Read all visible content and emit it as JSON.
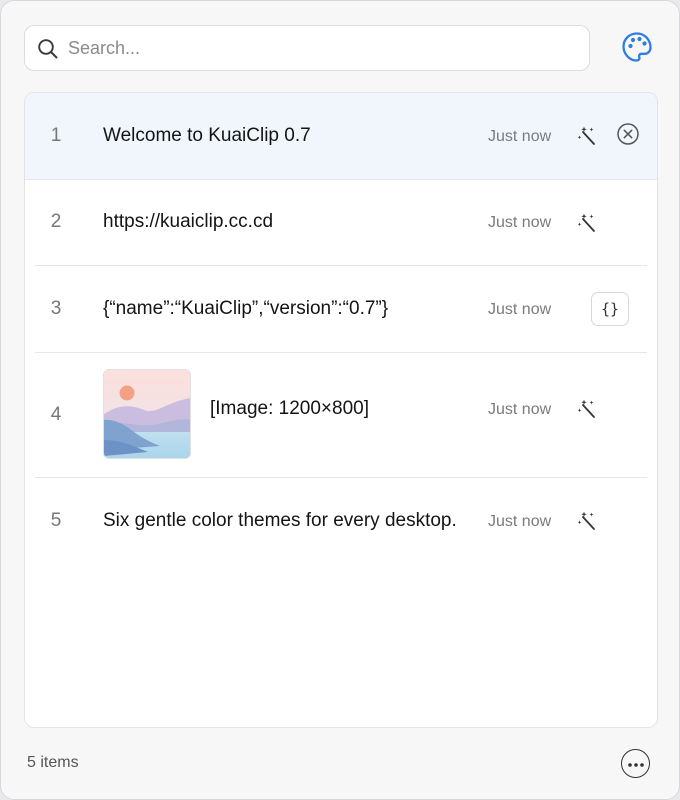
{
  "search": {
    "placeholder": "Search...",
    "value": ""
  },
  "header": {
    "palette_icon": "palette-icon",
    "accent_color": "#2f7de1"
  },
  "items": [
    {
      "index": "1",
      "text": "Welcome to KuaiClip 0.7",
      "time": "Just now",
      "action": "magic-wand-icon",
      "selected": true
    },
    {
      "index": "2",
      "text": "https://kuaiclip.cc.cd",
      "time": "Just now",
      "action": "magic-wand-icon"
    },
    {
      "index": "3",
      "text": "{“name”:“KuaiClip”,“version”:“0.7”}",
      "time": "Just now",
      "action_label": "{}"
    },
    {
      "index": "4",
      "text": "[Image: 1200×800]",
      "time": "Just now",
      "action": "magic-wand-icon",
      "thumbnail": "landscape-image-thumbnail"
    },
    {
      "index": "5",
      "text": "Six gentle color themes for every desktop.",
      "time": "Just now",
      "action": "magic-wand-icon"
    }
  ],
  "footer": {
    "count_label": "5 items",
    "more_icon": "more-options-icon"
  },
  "colors": {
    "selected_row": "#f1f6fd",
    "window_bg": "#f7f7f8"
  }
}
